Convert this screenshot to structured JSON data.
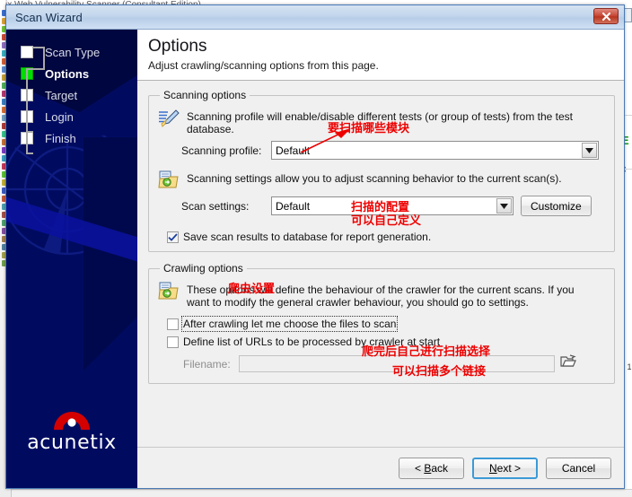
{
  "background": {
    "top_window_title": "ix Web Vulnerability Scanner (Consultant Edition)",
    "right_fragments": [
      "E",
      "C",
      "0 1"
    ]
  },
  "window": {
    "title": "Scan Wizard",
    "close_icon": "close-icon"
  },
  "sidebar": {
    "steps": [
      {
        "label": "Scan Type",
        "state": "pending"
      },
      {
        "label": "Options",
        "state": "current"
      },
      {
        "label": "Target",
        "state": "pending"
      },
      {
        "label": "Login",
        "state": "pending"
      },
      {
        "label": "Finish",
        "state": "pending"
      }
    ],
    "logo_text": "acunetix",
    "logo_color": "#d40000"
  },
  "header": {
    "title": "Options",
    "subtitle": "Adjust crawling/scanning options from this page."
  },
  "scanning_options": {
    "legend": "Scanning options",
    "profile_desc": "Scanning profile will enable/disable different tests (or group of tests) from the test database.",
    "profile_icon": "pen-highlighter-icon",
    "profile_label": "Scanning profile:",
    "profile_value": "Default",
    "settings_desc": "Scanning settings allow you to adjust scanning behavior to the current scan(s).",
    "settings_icon": "folder-settings-icon",
    "settings_label": "Scan settings:",
    "settings_value": "Default",
    "customize_button": "Customize",
    "save_results_label": "Save scan results to database for report generation.",
    "save_results_checked": true
  },
  "crawling_options": {
    "legend": "Crawling options",
    "desc": "These options will define the behaviour of the crawler for the current scans. If you want to modify the general crawler behaviour, you should go to settings.",
    "desc_icon": "folder-settings-icon",
    "after_crawling_label": "After crawling let me choose the files to scan",
    "after_crawling_checked": false,
    "define_urls_label": "Define list of URLs to be processed by crawler at start",
    "define_urls_checked": false,
    "filename_label": "Filename:",
    "filename_value": "",
    "browse_icon": "open-folder-icon"
  },
  "annotations": {
    "color": "#ee0000",
    "profile_note": "要扫描哪些模块",
    "settings_note_line1": "扫描的配置",
    "settings_note_line2": "可以自己定义",
    "crawling_note": "爬虫设置",
    "after_crawling_note": "爬完后自己进行扫描选择",
    "define_urls_note": "可以扫描多个链接"
  },
  "footer": {
    "back_button": "< Back",
    "back_mnemonic": "B",
    "next_button": "Next >",
    "next_mnemonic": "N",
    "cancel_button": "Cancel",
    "default_button": "Next >"
  }
}
